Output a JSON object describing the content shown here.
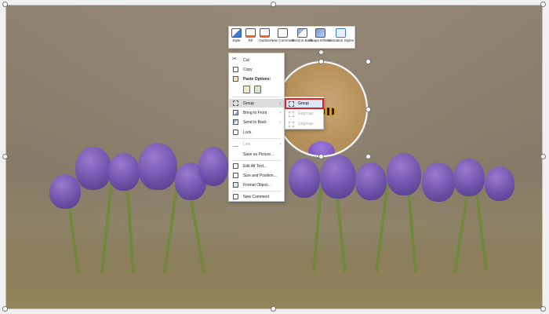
{
  "mini_toolbar": {
    "buttons": [
      {
        "label": "Style",
        "icon": "style-icon"
      },
      {
        "label": "Fill",
        "icon": "fill-icon"
      },
      {
        "label": "Outline",
        "icon": "outline-icon"
      },
      {
        "label": "New Comment",
        "icon": "comment-icon"
      },
      {
        "label": "Send to Back",
        "icon": "send-to-back-icon"
      },
      {
        "label": "Shape Effects",
        "icon": "shape-effects-icon"
      },
      {
        "label": "Animation Styles",
        "icon": "animation-icon"
      }
    ]
  },
  "context_menu": {
    "items": {
      "cut": "Cut",
      "copy": "Copy",
      "paste_options": "Paste Options:",
      "group": "Group",
      "bring_to_front": "Bring to Front",
      "send_to_back": "Send to Back",
      "lock": "Lock",
      "link": "Link",
      "save_as_picture": "Save as Picture...",
      "edit_alt_text": "Edit Alt Text...",
      "size_and_position": "Size and Position...",
      "format_object": "Format Object...",
      "new_comment": "New Comment"
    }
  },
  "submenu": {
    "items": {
      "group": "Group",
      "regroup": "Regroup",
      "ungroup": "Ungroup"
    }
  },
  "colors": {
    "highlight_border": "#e02020",
    "accent": "#3a7bd5"
  }
}
